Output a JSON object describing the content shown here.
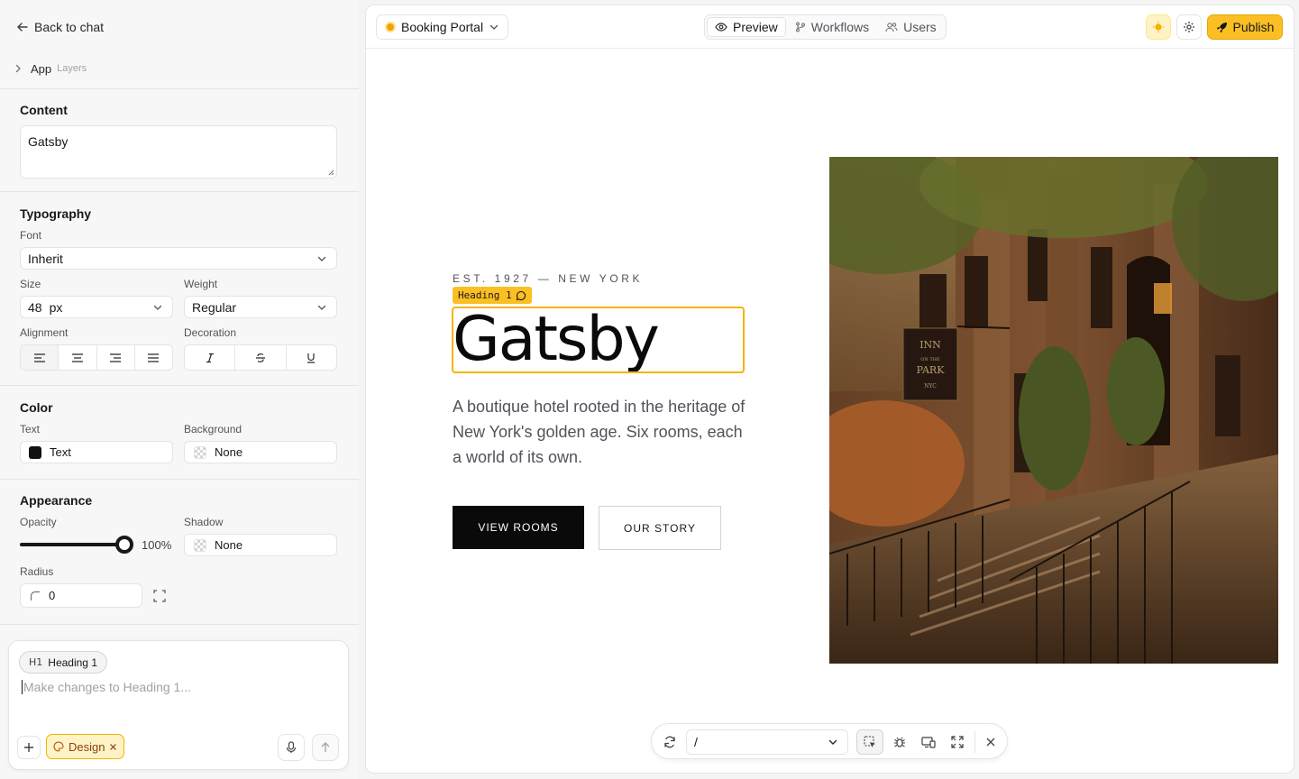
{
  "sidebar": {
    "back_label": "Back to chat",
    "breadcrumb": {
      "app": "App",
      "layers": "Layers"
    },
    "content": {
      "title": "Content",
      "value": "Gatsby"
    },
    "typography": {
      "title": "Typography",
      "font_label": "Font",
      "font_value": "Inherit",
      "size_label": "Size",
      "size_value": "48",
      "size_unit": "px",
      "weight_label": "Weight",
      "weight_value": "Regular",
      "alignment_label": "Alignment",
      "alignment_options": [
        "align-left",
        "align-center",
        "align-right",
        "align-justify"
      ],
      "decoration_label": "Decoration",
      "decoration_options": [
        "italic",
        "strikethrough",
        "underline"
      ]
    },
    "color": {
      "title": "Color",
      "text_label": "Text",
      "text_value": "Text",
      "text_swatch": "#111111",
      "background_label": "Background",
      "background_value": "None"
    },
    "appearance": {
      "title": "Appearance",
      "opacity_label": "Opacity",
      "opacity_value": "100%",
      "opacity_fraction": 1.0,
      "shadow_label": "Shadow",
      "shadow_value": "None",
      "radius_label": "Radius",
      "radius_value": "0"
    },
    "chat": {
      "chip_glyph": "H1",
      "chip_label": "Heading 1",
      "placeholder": "Make changes to Heading 1...",
      "design_chip": "Design"
    }
  },
  "topbar": {
    "project": "Booking Portal",
    "tabs": [
      {
        "label": "Preview",
        "icon": "eye-icon",
        "active": true
      },
      {
        "label": "Workflows",
        "icon": "git-branch-icon",
        "active": false
      },
      {
        "label": "Users",
        "icon": "users-icon",
        "active": false
      }
    ],
    "publish_label": "Publish",
    "accent": "#fbbf24"
  },
  "preview": {
    "eyebrow": "EST. 1927 — NEW YORK",
    "selection_tag": "Heading 1",
    "title": "Gatsby",
    "copy": "A boutique hotel rooted in the heritage of New York's golden age. Six rooms, each a world of its own.",
    "primary_button": "VIEW ROOMS",
    "secondary_button": "OUR STORY",
    "image_sign_lines": [
      "INN",
      "ON THE",
      "PARK",
      "NYC"
    ]
  },
  "bottom_toolbar": {
    "route": "/",
    "icons": [
      "refresh-icon",
      "select-element-icon",
      "bug-icon",
      "responsive-icon",
      "fullscreen-icon",
      "close-icon"
    ]
  }
}
